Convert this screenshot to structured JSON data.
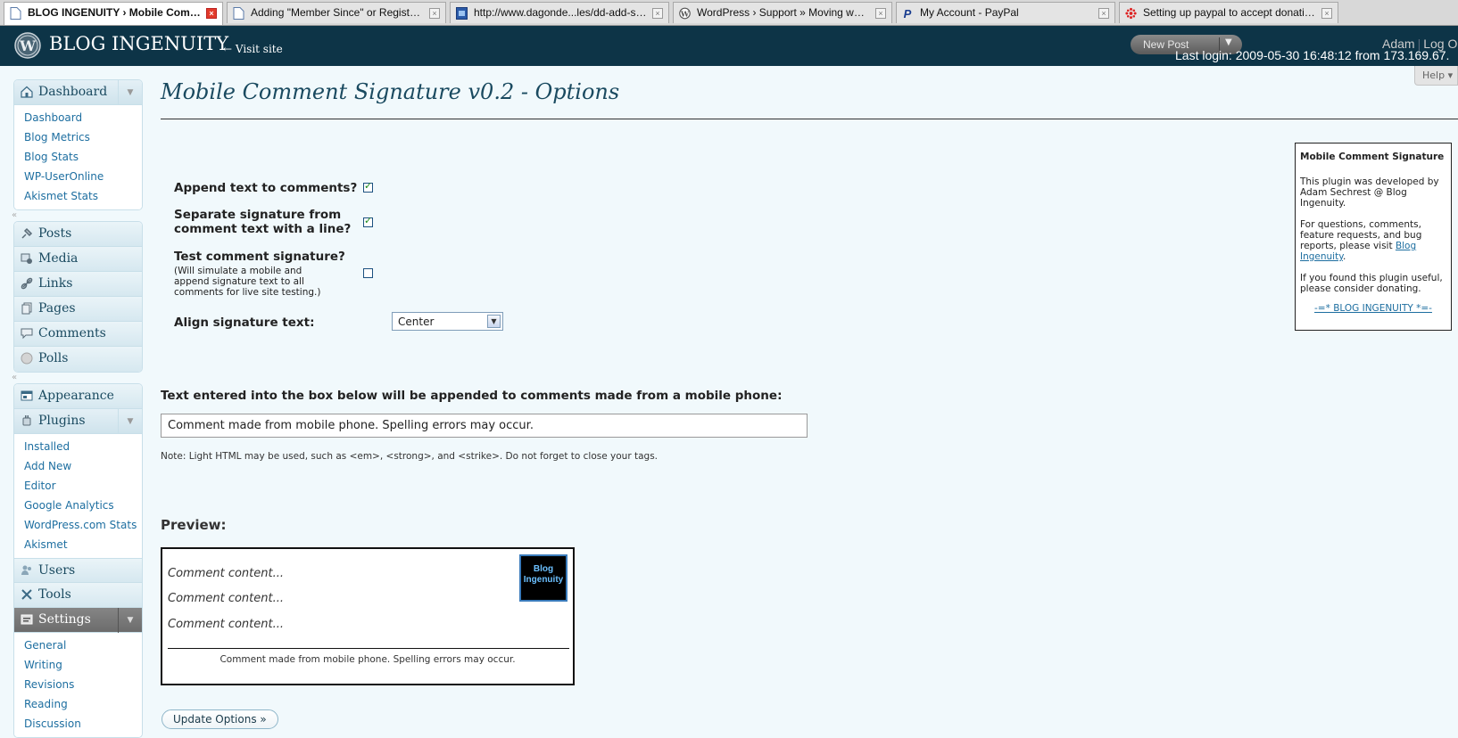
{
  "browser": {
    "tabs": [
      {
        "label": "BLOG INGENUITY › Mobile Comme...",
        "icon": "page-icon",
        "active": true
      },
      {
        "label": "Adding \"Member Since\" or Register Dat...",
        "icon": "page-icon"
      },
      {
        "label": "http://www.dagonde...les/dd-add-sig.txt",
        "icon": "image-page-icon"
      },
      {
        "label": "WordPress › Support » Moving wp-conf...",
        "icon": "wordpress-icon"
      },
      {
        "label": "My Account - PayPal",
        "icon": "paypal-icon"
      },
      {
        "label": "Setting up paypal to accept donations. ...",
        "icon": "flower-icon"
      }
    ],
    "close_glyph": "×"
  },
  "header": {
    "blog_name": "BLOG INGENUITY",
    "visit_site": "← Visit site",
    "new_post": "New Post",
    "new_post_arrow": "▼",
    "user": "Adam",
    "logout": "Log O",
    "user_separator": "|",
    "last_login": "Last login: 2009-05-30 16:48:12 from 173.169.67.",
    "help": "Help ▾",
    "bg_color": "#0d3447"
  },
  "menu": {
    "dashboard": {
      "label": "Dashboard",
      "icon": "dashboard-icon",
      "items": [
        "Dashboard",
        "Blog Metrics",
        "Blog Stats",
        "WP-UserOnline",
        "Akismet Stats"
      ]
    },
    "separator_glyph": "«",
    "toggle_glyph": "▼",
    "posts": {
      "label": "Posts",
      "icon": "pin-icon"
    },
    "media": {
      "label": "Media",
      "icon": "media-icon"
    },
    "links": {
      "label": "Links",
      "icon": "link-icon"
    },
    "pages": {
      "label": "Pages",
      "icon": "pages-icon"
    },
    "comments": {
      "label": "Comments",
      "icon": "comment-icon"
    },
    "polls": {
      "label": "Polls",
      "icon": "polls-icon"
    },
    "appearance": {
      "label": "Appearance",
      "icon": "appearance-icon"
    },
    "plugins": {
      "label": "Plugins",
      "icon": "plugin-icon",
      "items": [
        "Installed",
        "Add New",
        "Editor",
        "Google Analytics",
        "WordPress.com Stats",
        "Akismet Configuration"
      ]
    },
    "users": {
      "label": "Users",
      "icon": "users-icon"
    },
    "tools": {
      "label": "Tools",
      "icon": "tools-icon"
    },
    "settings": {
      "label": "Settings",
      "icon": "settings-icon",
      "items": [
        "General",
        "Writing",
        "Revisions",
        "Reading",
        "Discussion"
      ]
    }
  },
  "page": {
    "title": "Mobile Comment Signature v0.2 - Options",
    "append_label": "Append text to comments?",
    "append_checked": true,
    "separate_label_1": "Separate signature from",
    "separate_label_2": "comment text with a line?",
    "separate_checked": true,
    "test_label": "Test comment signature?",
    "test_sub_1": "(Will simulate a mobile and",
    "test_sub_2": "append signature text to all",
    "test_sub_3": "comments for live site testing.)",
    "test_checked": false,
    "align_label": "Align signature text:",
    "align_value": "Center",
    "text_label": "Text entered into the box below will be appended to comments made from a mobile phone:",
    "signature_text": "Comment made from mobile phone. Spelling errors may occur.",
    "note": "Note: Light HTML may be used, such as <em>, <strong>, and <strike>. Do not forget to close your tags.",
    "preview_label": "Preview:",
    "preview_comments": [
      "Comment content...",
      "Comment content...",
      "Comment content..."
    ],
    "preview_logo_line1": "Blog",
    "preview_logo_line2": "Ingenuity",
    "preview_signature": "Comment made from mobile phone. Spelling errors may occur.",
    "update_button": "Update Options »"
  },
  "sidebox": {
    "title": "Mobile Comment Signature",
    "p1": "This plugin was developed by Adam Sechrest @ Blog Ingenuity.",
    "p2_prefix": "For questions, comments, feature requests, and bug reports, please visit ",
    "p2_link": "Blog Ingenuity",
    "p2_suffix": ".",
    "p3": "If you found this plugin useful, please consider donating.",
    "link": "-=* BLOG INGENUITY *=-"
  }
}
